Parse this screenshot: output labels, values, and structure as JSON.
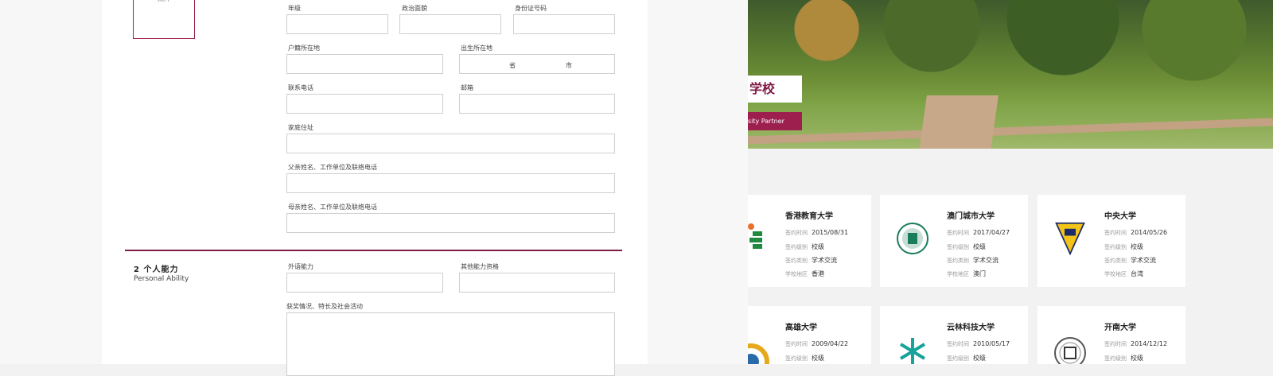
{
  "form": {
    "photo_label": "照片",
    "fields": [
      {
        "label": "年级",
        "value": ""
      },
      {
        "label": "政治面貌",
        "value": ""
      },
      {
        "label": "身份证号码",
        "value": ""
      },
      {
        "label": "户籍所在地",
        "value": ""
      },
      {
        "label": "出生所在地",
        "value": "",
        "suffix_province": "省",
        "suffix_city": "市"
      },
      {
        "label": "联系电话",
        "value": ""
      },
      {
        "label": "邮箱",
        "value": ""
      },
      {
        "label": "家庭住址",
        "value": ""
      },
      {
        "label": "父亲姓名、工作单位及联络电话",
        "value": ""
      },
      {
        "label": "母亲姓名、工作单位及联络电话",
        "value": ""
      }
    ],
    "section2": {
      "title": "2 个人能力",
      "subtitle": "Personal Ability",
      "fields": [
        {
          "label": "外语能力",
          "value": ""
        },
        {
          "label": "其他能力资格",
          "value": ""
        },
        {
          "label": "获奖情况、特长及社会活动",
          "value": ""
        }
      ]
    }
  },
  "hero": {
    "title_partial": "学校",
    "subtitle_partial": "sity Partner"
  },
  "schools": [
    {
      "name": "香港教育大学",
      "date_label": "签约时间",
      "date": "2015/08/31",
      "level_label": "签约级别",
      "level": "校级",
      "type_label": "签约类别",
      "type": "学术交流",
      "region_label": "学校地区",
      "region": "香港"
    },
    {
      "name": "澳门城市大学",
      "date_label": "签约时间",
      "date": "2017/04/27",
      "level_label": "签约级别",
      "level": "校级",
      "type_label": "签约类别",
      "type": "学术交流",
      "region_label": "学校地区",
      "region": "澳门"
    },
    {
      "name": "中央大学",
      "date_label": "签约时间",
      "date": "2014/05/26",
      "level_label": "签约级别",
      "level": "校级",
      "type_label": "签约类别",
      "type": "学术交流",
      "region_label": "学校地区",
      "region": "台湾"
    },
    {
      "name": "高雄大学",
      "date_label": "签约时间",
      "date": "2009/04/22",
      "level_label": "签约级别",
      "level": "校级"
    },
    {
      "name": "云林科技大学",
      "date_label": "签约时间",
      "date": "2010/05/17",
      "level_label": "签约级别",
      "level": "校级"
    },
    {
      "name": "开南大学",
      "date_label": "签约时间",
      "date": "2014/12/12",
      "level_label": "签约级别",
      "level": "校级"
    }
  ],
  "colors": {
    "accent": "#7e1a43",
    "accent_light": "#9c1f4d",
    "border": "#cfcfcf"
  }
}
